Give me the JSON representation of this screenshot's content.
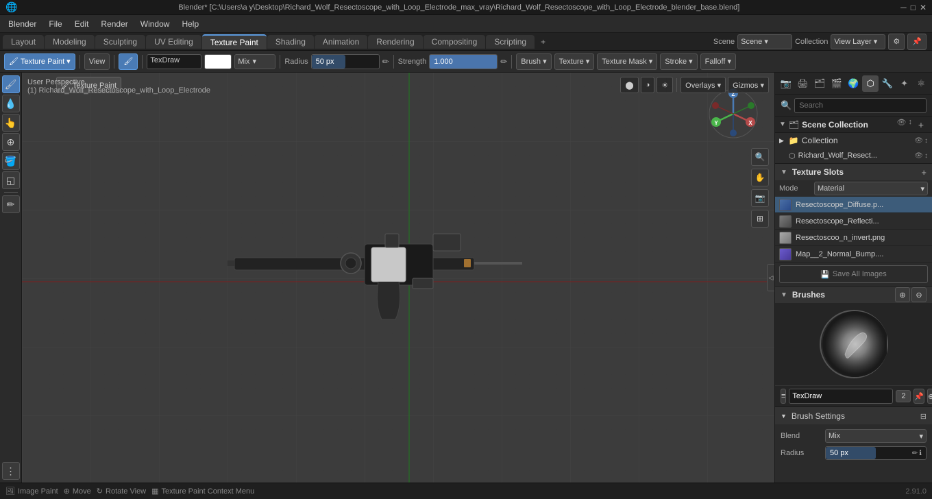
{
  "titlebar": {
    "title": "Blender* [C:\\Users\\a y\\Desktop\\Richard_Wolf_Resectoscope_with_Loop_Electrode_max_vray\\Richard_Wolf_Resectoscope_with_Loop_Electrode_blender_base.blend]",
    "minimize": "─",
    "maximize": "□",
    "close": "✕"
  },
  "menubar": {
    "items": [
      "Blender",
      "File",
      "Edit",
      "Render",
      "Window",
      "Help"
    ]
  },
  "workspace_tabs": {
    "tabs": [
      "Layout",
      "Modeling",
      "Sculpting",
      "UV Editing",
      "Texture Paint",
      "Shading",
      "Animation",
      "Rendering",
      "Compositing",
      "Scripting"
    ],
    "active": "Texture Paint",
    "add_label": "+"
  },
  "toolbar": {
    "mode_label": "Texture Paint",
    "mode_icon": "🖌",
    "view_label": "View",
    "brush_name": "TexDraw",
    "color_white": "#ffffff",
    "blend_label": "Mix",
    "radius_label": "Radius",
    "radius_value": "50 px",
    "pen_icon": "✏",
    "strength_label": "Strength",
    "strength_value": "1.000",
    "brush_label": "Brush ▾",
    "texture_label": "Texture ▾",
    "texture_mask_label": "Texture Mask ▾",
    "stroke_label": "Stroke ▾",
    "falloff_label": "Falloff ▾"
  },
  "viewport": {
    "title": "User Perspective",
    "subtitle": "(1) Richard_Wolf_Resectoscope_with_Loop_Electrode"
  },
  "gizmo": {
    "x_label": "X",
    "y_label": "Y",
    "z_label": "Z"
  },
  "right_panel": {
    "search_placeholder": "Search",
    "icons": [
      "scene",
      "world",
      "object",
      "modifier",
      "particles",
      "physics",
      "constraints",
      "data",
      "material",
      "shading"
    ],
    "scene_collection_label": "Scene Collection",
    "collection_label": "Collection",
    "collection_item": "Richard_Wolf_Resect...",
    "texture_slots_header": "Texture Slots",
    "mode_label": "Mode",
    "mode_value": "Material",
    "texture_slots": [
      {
        "name": "Resectoscope_Diffuse.p...",
        "color": "#4a6fa5",
        "selected": true
      },
      {
        "name": "Resectoscope_Reflecti...",
        "color": "#5a5a5a"
      },
      {
        "name": "Resectoscoo_n_invert.png",
        "color": "#7a7a7a"
      },
      {
        "name": "Map__2_Normal_Bump....",
        "color": "#6a5acd"
      }
    ],
    "save_all_images_label": "Save All Images",
    "brushes_header": "Brushes",
    "brush_name": "TexDraw",
    "brush_count": "2",
    "brush_settings_header": "Brush Settings",
    "blend_label": "Blend",
    "blend_value": "Mix",
    "radius_label": "Radius",
    "radius_value": "50 px"
  },
  "status_bar": {
    "image_paint_label": "Image Paint",
    "image_paint_icon": "🖼",
    "move_label": "Move",
    "move_icon": "⊕",
    "rotate_label": "Rotate View",
    "rotate_icon": "↻",
    "context_menu_label": "Texture Paint Context Menu",
    "context_icon": "▦",
    "version": "2.91.0"
  },
  "colors": {
    "bg": "#2b2b2b",
    "panel_bg": "#252525",
    "active_tab": "#4a7bb5",
    "border": "#1a1a1a",
    "accent": "#5d9bdf",
    "grid": "#3a3a3a"
  }
}
